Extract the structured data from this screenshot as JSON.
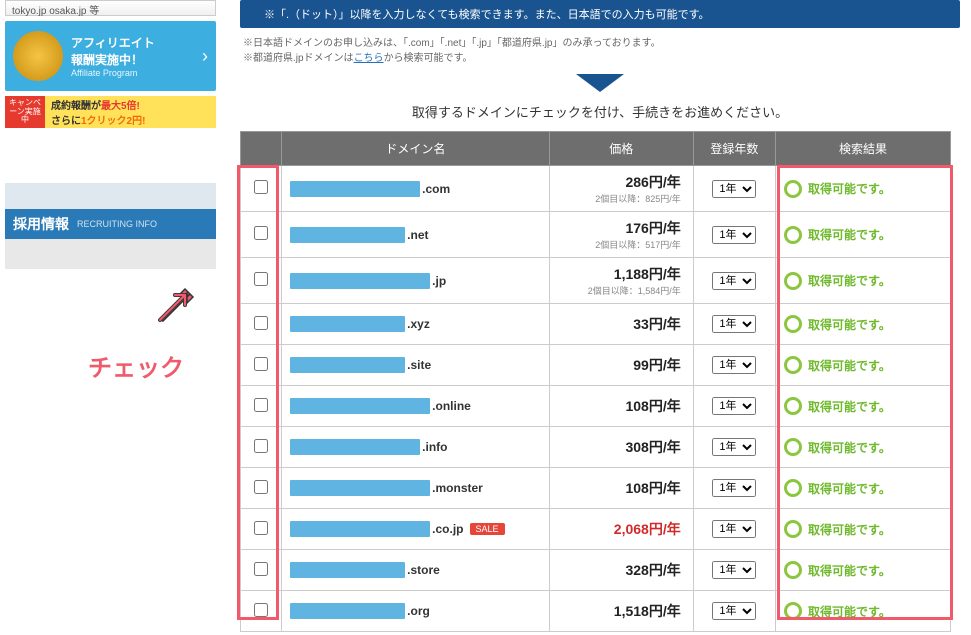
{
  "sidebar": {
    "tokyo_text": "tokyo.jp osaka.jp 等",
    "affiliate": {
      "line1": "アフィリエイト",
      "line2": "報酬実施中！",
      "sub": "Affiliate Program"
    },
    "campaign": {
      "badge": "キャンペーン実施中",
      "line1_pre": "成約報酬が",
      "line1_red": "最大5倍!",
      "line2_pre": "さらに",
      "line2_orange": "1クリック2円!"
    },
    "recruit": {
      "title": "採用情報",
      "sub": "RECRUITING INFO"
    }
  },
  "notes": {
    "blue_bar": "※「.（ドット）」以降を入力しなくても検索できます。また、日本語での入力も可能です。",
    "line1": "※日本語ドメインのお申し込みは、「.com」「.net」「.jp」「都道府県.jp」のみ承っております。",
    "line2_pre": "※都道府県.jpドメインは",
    "line2_link": "こちら",
    "line2_post": "から検索可能です。"
  },
  "instruction": "取得するドメインにチェックを付け、手続きをお進めください。",
  "headers": {
    "domain": "ドメイン名",
    "price": "価格",
    "years": "登録年数",
    "result": "検索結果"
  },
  "year_option": "1年",
  "available_text": "取得可能です。",
  "sale_label": "SALE",
  "rows": [
    {
      "ext": ".com",
      "price": "286円/年",
      "sub": "2個目以降：825円/年",
      "sale": false,
      "red": false,
      "bw": "w1"
    },
    {
      "ext": ".net",
      "price": "176円/年",
      "sub": "2個目以降：517円/年",
      "sale": false,
      "red": false,
      "bw": "w2"
    },
    {
      "ext": ".jp",
      "price": "1,188円/年",
      "sub": "2個目以降：1,584円/年",
      "sale": false,
      "red": false,
      "bw": "w3"
    },
    {
      "ext": ".xyz",
      "price": "33円/年",
      "sub": "",
      "sale": false,
      "red": false,
      "bw": "w2"
    },
    {
      "ext": ".site",
      "price": "99円/年",
      "sub": "",
      "sale": false,
      "red": false,
      "bw": "w2"
    },
    {
      "ext": ".online",
      "price": "108円/年",
      "sub": "",
      "sale": false,
      "red": false,
      "bw": "w3"
    },
    {
      "ext": ".info",
      "price": "308円/年",
      "sub": "",
      "sale": false,
      "red": false,
      "bw": "w1"
    },
    {
      "ext": ".monster",
      "price": "108円/年",
      "sub": "",
      "sale": false,
      "red": false,
      "bw": "w3"
    },
    {
      "ext": ".co.jp",
      "price": "2,068円/年",
      "sub": "",
      "sale": true,
      "red": true,
      "bw": "w3"
    },
    {
      "ext": ".store",
      "price": "328円/年",
      "sub": "",
      "sale": false,
      "red": false,
      "bw": "w2"
    },
    {
      "ext": ".org",
      "price": "1,518円/年",
      "sub": "",
      "sale": false,
      "red": false,
      "bw": "w2"
    }
  ],
  "annotation": {
    "check_label": "チェック"
  }
}
